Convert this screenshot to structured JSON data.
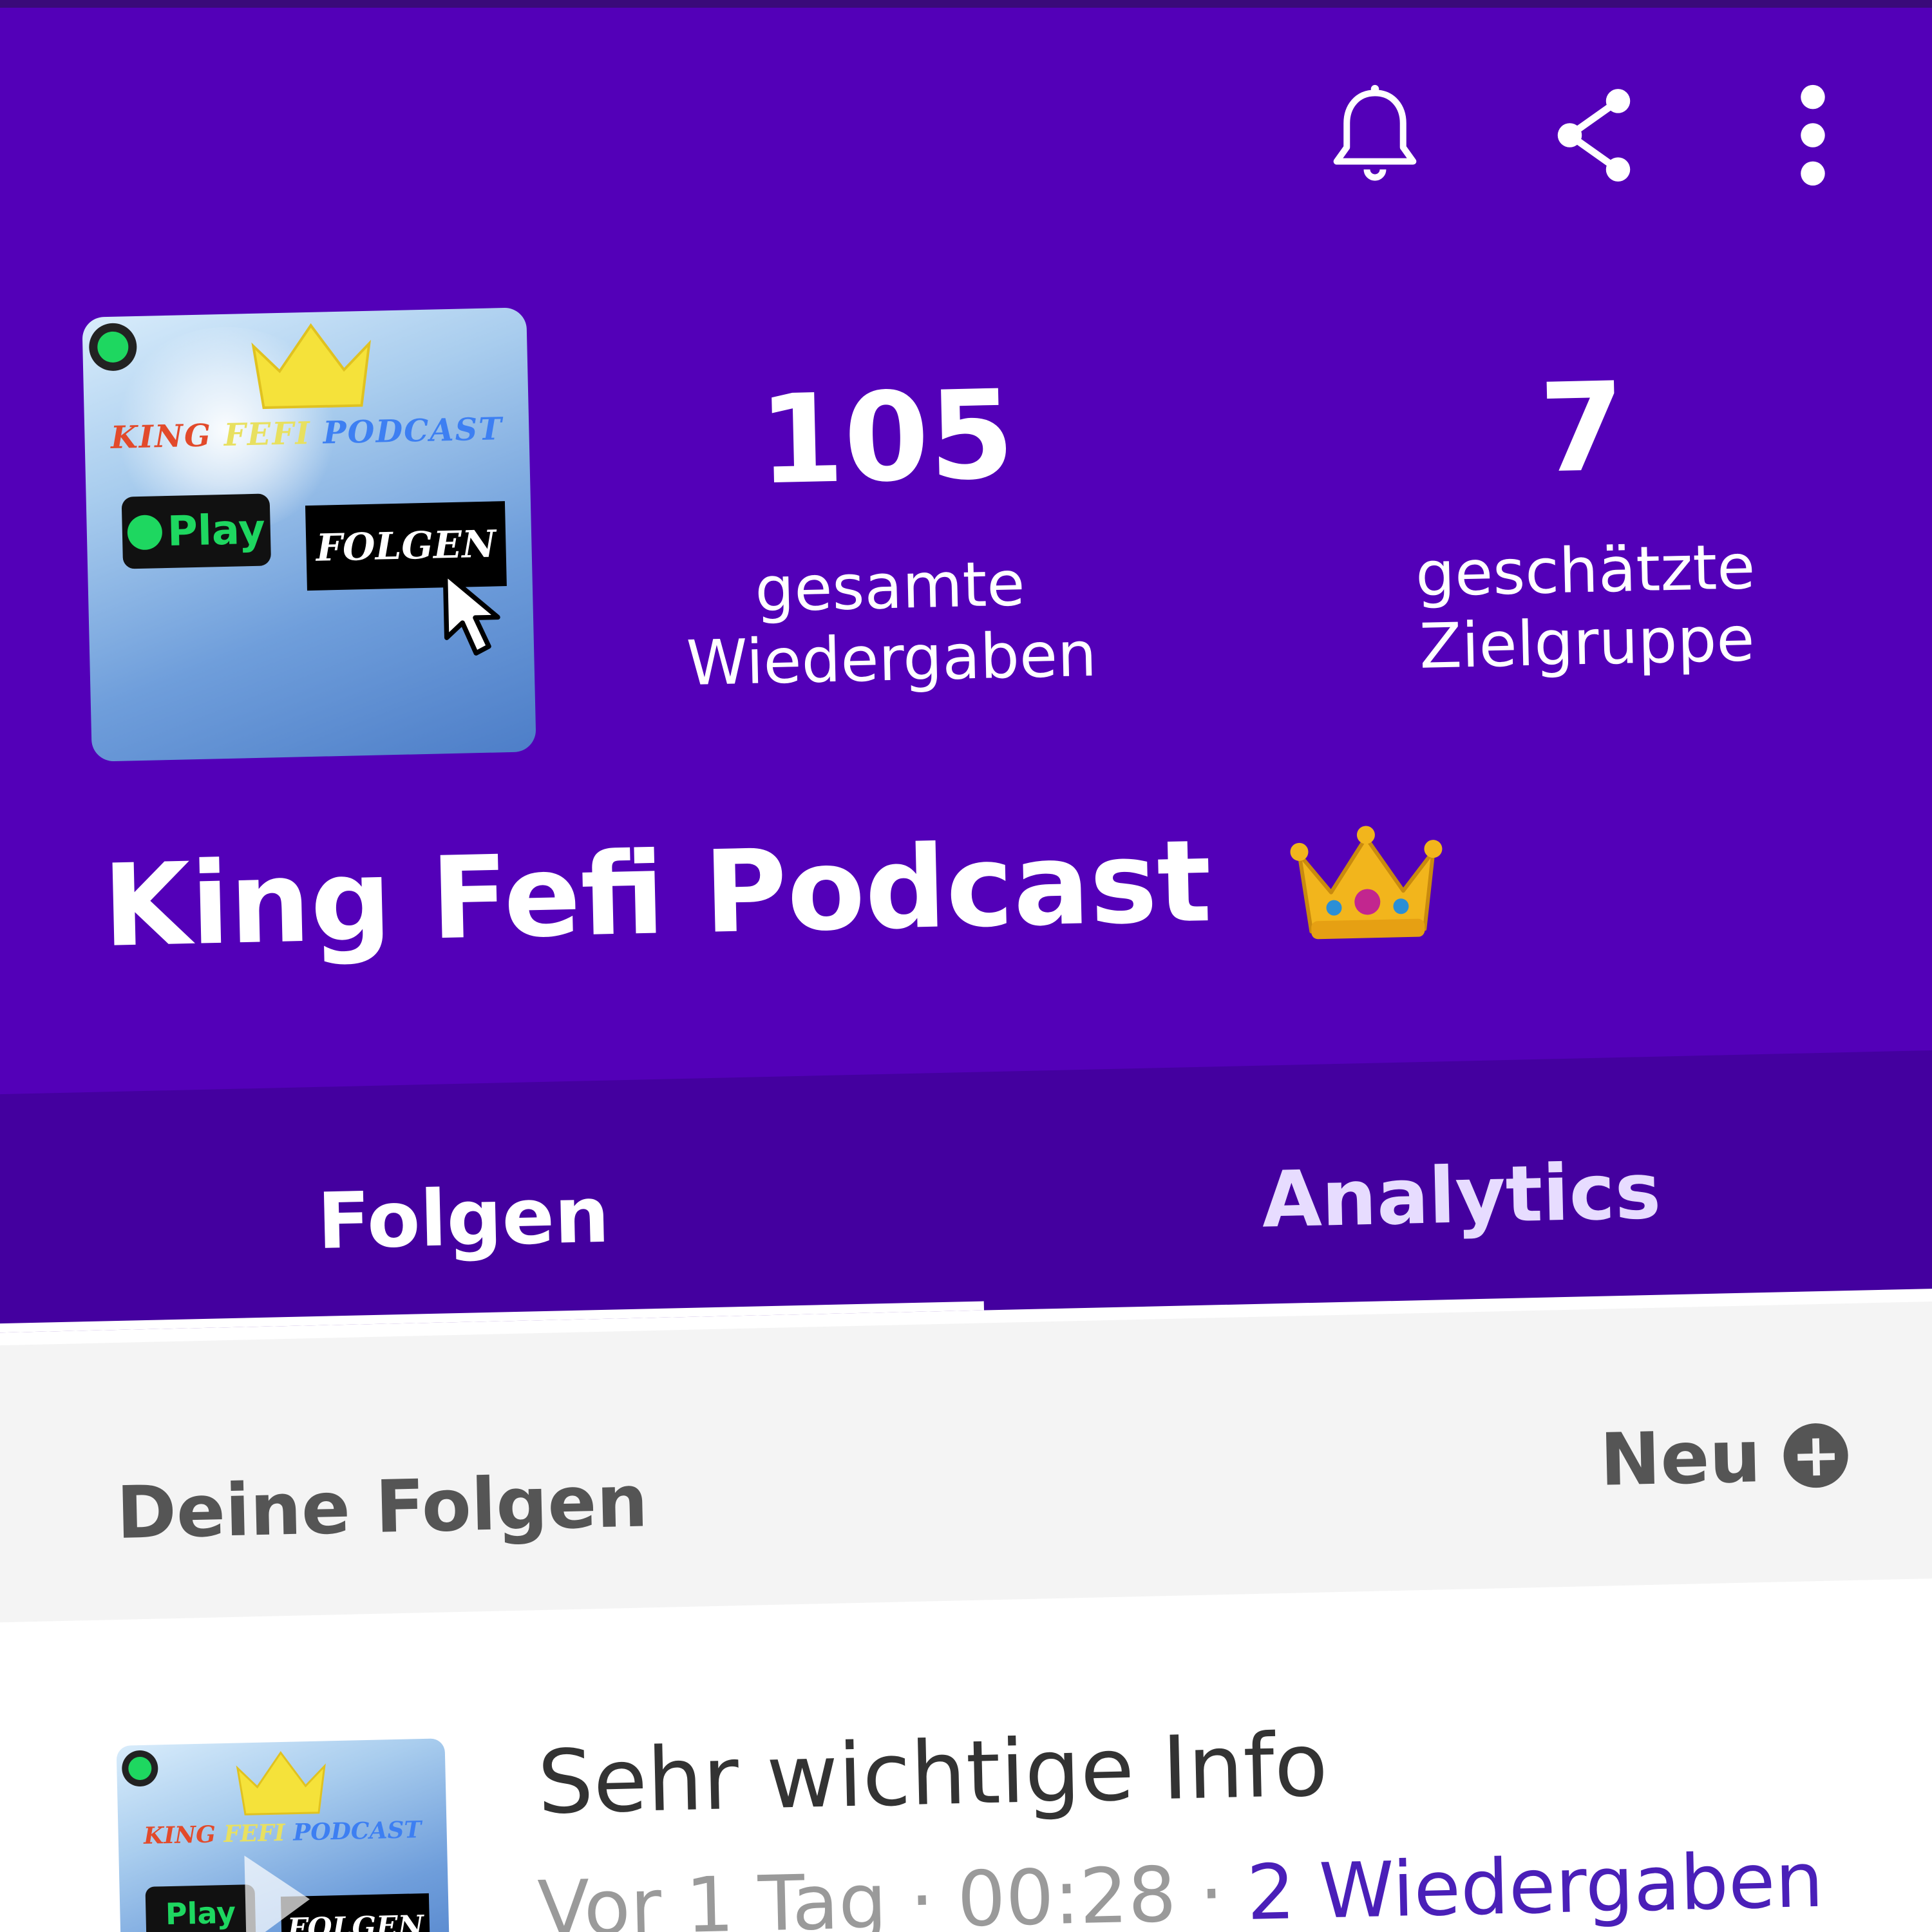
{
  "colors": {
    "header": "#5300b8",
    "tabbar": "#44009f",
    "accent": "#4a1fb8",
    "strip": "#f4f4f4"
  },
  "toolbar": {
    "icons": [
      "bell-icon",
      "share-icon",
      "more-vert-icon"
    ]
  },
  "podcast": {
    "name": "King Fefi Podcast",
    "title_emoji": "👑",
    "cover_art": {
      "word_1": "KING",
      "word_2": "FEFI",
      "word_3": "PODCAST",
      "play_text": "Play",
      "button_text": "FOLGEN"
    }
  },
  "stats": {
    "total_plays": {
      "value": "105",
      "label_line1": "gesamte",
      "label_line2": "Wiedergaben"
    },
    "audience": {
      "value": "7",
      "label_line1": "geschätzte",
      "label_line2": "Zielgruppe"
    }
  },
  "tabs": [
    {
      "label": "Folgen",
      "active": true
    },
    {
      "label": "Analytics",
      "active": false
    }
  ],
  "episodes_section": {
    "title": "Deine Folgen",
    "new_label": "Neu"
  },
  "episodes": [
    {
      "title": "Sehr wichtige Info",
      "age": "Vor 1 Tag",
      "duration": "00:28",
      "plays": "2 Wiedergaben"
    }
  ]
}
